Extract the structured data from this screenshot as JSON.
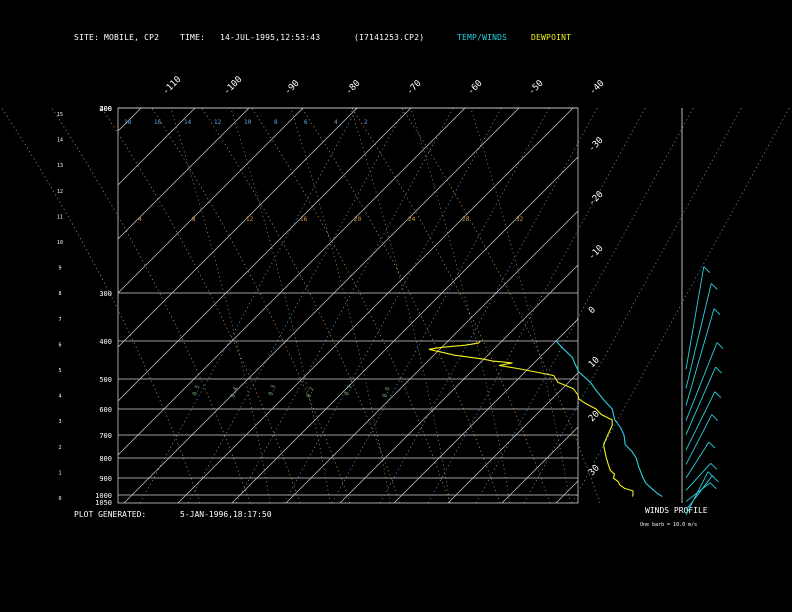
{
  "header": {
    "site_label": "SITE:",
    "site_value": "MOBILE, CP2",
    "time_label": "TIME:",
    "time_value": "14-JUL-1995,12:53:43",
    "file": "(I7141253.CP2)",
    "temp_winds": "TEMP/WINDS",
    "dewpoint": "DEWPOINT"
  },
  "footer": {
    "generated_label": "PLOT GENERATED:",
    "generated_value": "5-JAN-1996,18:17:50",
    "winds_profile": "WINDS PROFILE",
    "barb_note": "One barb = 10.0 m/s"
  },
  "colors": {
    "background": "#000000",
    "grid": "#cfcfcf",
    "temperature": "#2ad1df",
    "dewpoint": "#f2f21a",
    "mixing_ratio": "#5aa6e6",
    "dry_adiabat": "#d99a4a",
    "moist_adiabat": "#6fa86f"
  },
  "chart_data": {
    "type": "line",
    "diagram": "skew-T log-P",
    "pressure_levels": [
      400,
      200,
      300,
      400,
      500,
      600,
      700,
      800,
      900,
      1000,
      1050
    ],
    "height_ticks_km": [
      15,
      14,
      13,
      12,
      11,
      10,
      9,
      8,
      7,
      6,
      5,
      4,
      3,
      2,
      1,
      0
    ],
    "isotherm_labels_top": [
      -110,
      -100,
      -90,
      -80,
      -70,
      -60,
      -50,
      -40
    ],
    "isotherm_labels_right": [
      -30,
      -20,
      -10,
      0,
      10,
      20,
      30
    ],
    "mixing_ratio_labels": [
      "18",
      "16",
      "14",
      "12",
      "10",
      "8",
      "6",
      "4",
      "2"
    ],
    "dry_adiabat_labels": [
      "0.5",
      "0.4",
      "0.3",
      "0.2",
      "0.1",
      "0.0"
    ],
    "moist_adiabat_labels": [
      "4",
      "8",
      "12",
      "16",
      "20",
      "24",
      "28",
      "32"
    ],
    "series": [
      {
        "name": "TEMP/WINDS",
        "points": [
          [
            1010,
            28.5
          ],
          [
            990,
            27
          ],
          [
            960,
            25
          ],
          [
            930,
            23
          ],
          [
            900,
            21.5
          ],
          [
            870,
            20
          ],
          [
            840,
            18.5
          ],
          [
            800,
            16.5
          ],
          [
            770,
            14.5
          ],
          [
            740,
            12
          ],
          [
            700,
            10
          ],
          [
            670,
            8
          ],
          [
            640,
            5.5
          ],
          [
            600,
            3
          ],
          [
            570,
            0
          ],
          [
            540,
            -3
          ],
          [
            510,
            -6
          ],
          [
            480,
            -10
          ],
          [
            460,
            -12
          ],
          [
            440,
            -14
          ],
          [
            420,
            -17
          ],
          [
            400,
            -20
          ]
        ]
      },
      {
        "name": "DEWPOINT",
        "points": [
          [
            1010,
            23
          ],
          [
            990,
            22.5
          ],
          [
            975,
            22
          ],
          [
            960,
            20
          ],
          [
            940,
            18.5
          ],
          [
            920,
            17.5
          ],
          [
            900,
            16
          ],
          [
            880,
            15.5
          ],
          [
            860,
            14
          ],
          [
            840,
            13
          ],
          [
            820,
            12
          ],
          [
            800,
            11
          ],
          [
            780,
            10
          ],
          [
            760,
            9
          ],
          [
            740,
            8
          ],
          [
            720,
            7.5
          ],
          [
            700,
            7
          ],
          [
            680,
            6.5
          ],
          [
            660,
            6
          ],
          [
            640,
            5
          ],
          [
            620,
            2
          ],
          [
            600,
            0
          ],
          [
            580,
            -3
          ],
          [
            565,
            -5
          ],
          [
            550,
            -6
          ],
          [
            540,
            -7
          ],
          [
            530,
            -8
          ],
          [
            520,
            -10
          ],
          [
            510,
            -12
          ],
          [
            500,
            -13
          ],
          [
            490,
            -14
          ],
          [
            480,
            -18
          ],
          [
            470,
            -22
          ],
          [
            462,
            -26
          ],
          [
            455,
            -24
          ],
          [
            450,
            -28
          ],
          [
            445,
            -30
          ],
          [
            440,
            -33
          ],
          [
            435,
            -36
          ],
          [
            430,
            -38
          ],
          [
            425,
            -40
          ],
          [
            420,
            -42
          ],
          [
            415,
            -40
          ],
          [
            410,
            -36
          ],
          [
            405,
            -34
          ],
          [
            400,
            -34
          ]
        ]
      }
    ],
    "wind_profile": [
      {
        "pressure": 420,
        "speed": 12,
        "direction": 340
      },
      {
        "pressure": 470,
        "speed": 15,
        "direction": 330
      },
      {
        "pressure": 520,
        "speed": 14,
        "direction": 320
      },
      {
        "pressure": 570,
        "speed": 12,
        "direction": 300
      },
      {
        "pressure": 620,
        "speed": 10,
        "direction": 290
      },
      {
        "pressure": 680,
        "speed": 9,
        "direction": 280
      },
      {
        "pressure": 740,
        "speed": 7,
        "direction": 270
      },
      {
        "pressure": 800,
        "speed": 6,
        "direction": 250
      },
      {
        "pressure": 860,
        "speed": 8,
        "direction": 240
      },
      {
        "pressure": 920,
        "speed": 9,
        "direction": 230
      },
      {
        "pressure": 970,
        "speed": 8,
        "direction": 250
      },
      {
        "pressure": 1000,
        "speed": 5,
        "direction": 260
      }
    ]
  }
}
